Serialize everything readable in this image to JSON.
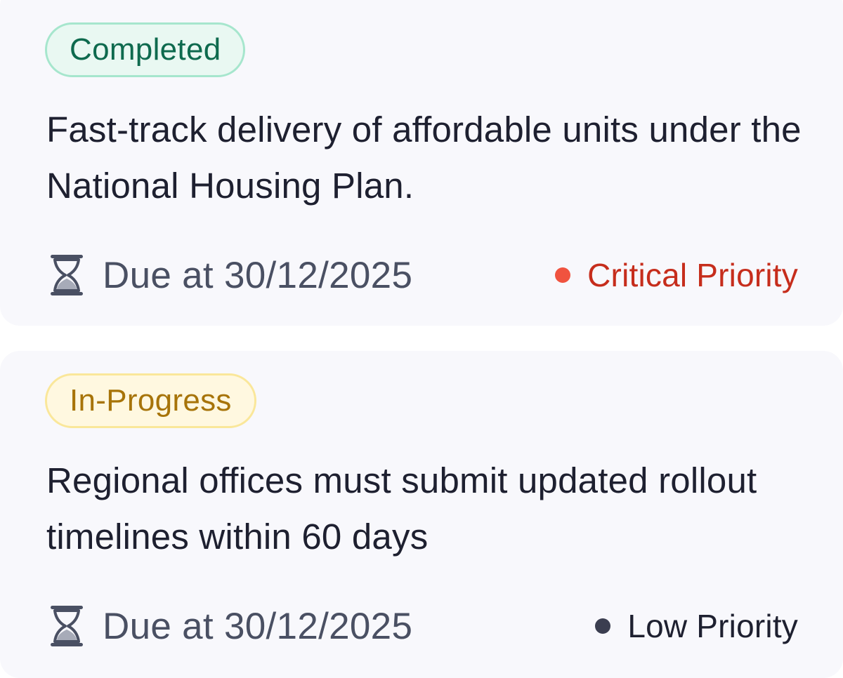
{
  "tasks": [
    {
      "status": "Completed",
      "description": "Fast-track delivery of affordable units under the National Housing Plan.",
      "due": "Due at 30/12/2025",
      "due_icon": "hourglass-icon",
      "priority": "Critical Priority",
      "priority_color": "#f0533f",
      "priority_text_color": "#c62d1c"
    },
    {
      "status": "In-Progress",
      "description": "Regional offices must submit updated rollout timelines within 60 days",
      "due": "Due at 30/12/2025",
      "due_icon": "hourglass-icon",
      "priority": "Low Priority",
      "priority_color": "#3b3e50",
      "priority_text_color": "#1e2030"
    }
  ]
}
